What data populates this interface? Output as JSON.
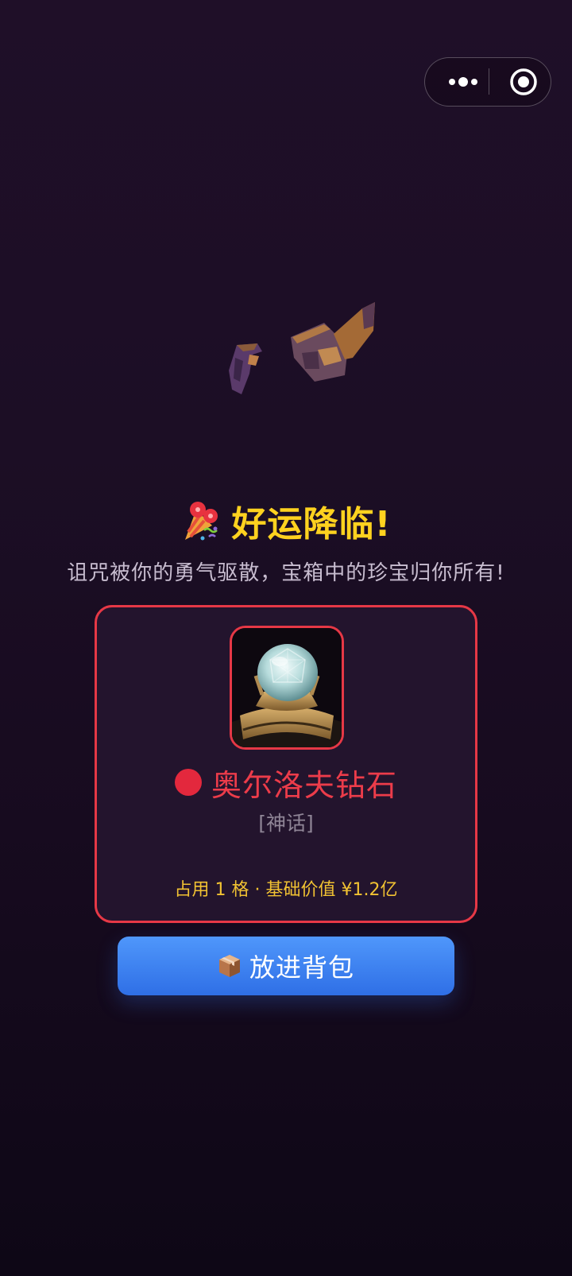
{
  "capsule": {
    "more_icon": "more-dots-icon",
    "close_icon": "target-circle-icon"
  },
  "result": {
    "confetti_icon": "party-popper-icon",
    "title": "好运降临!",
    "subtitle": "诅咒被你的勇气驱散，宝箱中的珍宝归你所有!"
  },
  "item": {
    "name": "奥尔洛夫钻石",
    "rarity": "[神话]",
    "rarity_color": "#e3283d",
    "stats": "占用 1 格 · 基础价值 ¥1.2亿",
    "image": "gem-ring-icon"
  },
  "action": {
    "icon": "package-icon",
    "label": "放进背包"
  },
  "colors": {
    "accent_gold": "#ffd21f",
    "frame_red": "#e63846",
    "button_blue": "#3f85f2"
  }
}
